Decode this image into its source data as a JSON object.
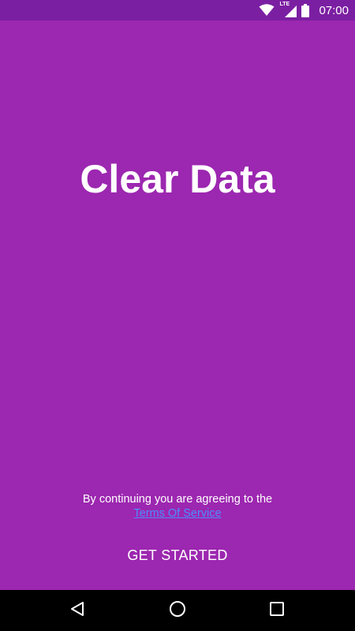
{
  "status_bar": {
    "network_label": "LTE",
    "time": "07:00"
  },
  "main": {
    "title": "Clear Data",
    "agreement_text": "By continuing you are agreeing to the",
    "tos_link": "Terms Of Service",
    "get_started_label": "GET STARTED"
  },
  "icons": {
    "wifi": "wifi-icon",
    "signal": "signal-icon",
    "battery": "battery-icon",
    "back": "back-icon",
    "home": "home-icon",
    "recent": "recent-apps-icon"
  },
  "colors": {
    "background": "#9c27b0",
    "status_bar": "#7b1fa2",
    "link": "#4d8cff",
    "nav_bar": "#000000"
  }
}
